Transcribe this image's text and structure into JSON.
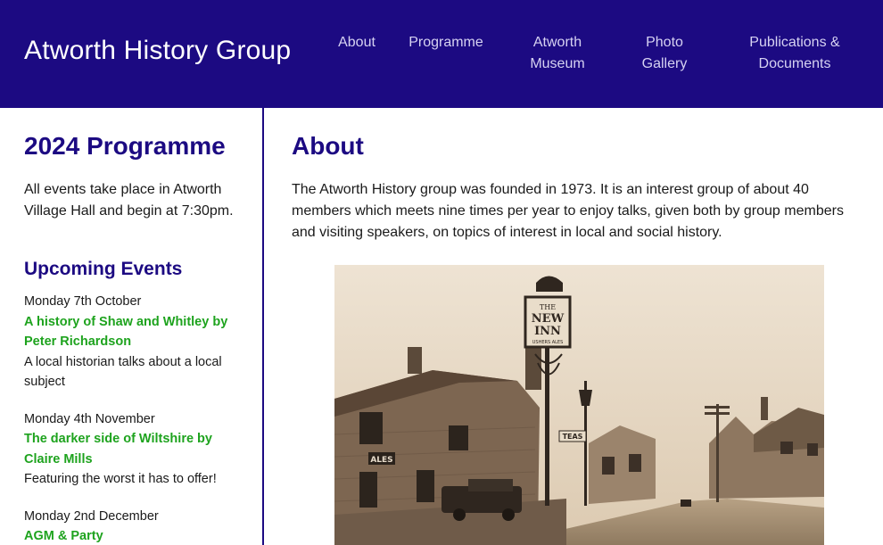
{
  "header": {
    "site_title": "Atworth History Group",
    "nav": [
      {
        "line1": "About",
        "line2": ""
      },
      {
        "line1": "Programme",
        "line2": ""
      },
      {
        "line1": "Atworth",
        "line2": "Museum"
      },
      {
        "line1": "Photo",
        "line2": "Gallery"
      },
      {
        "line1": "Publications &",
        "line2": "Documents"
      }
    ]
  },
  "sidebar": {
    "title": "2024 Programme",
    "intro": "All events take place in Atworth Village Hall and begin at 7:30pm.",
    "subtitle": "Upcoming Events",
    "events": [
      {
        "date": "Monday 7th October",
        "title": "A history of Shaw and Whitley by Peter Richardson",
        "desc": "A local historian talks about a local subject"
      },
      {
        "date": "Monday 4th November",
        "title": "The darker side of Wiltshire by Claire Mills",
        "desc": "Featuring the worst it has to offer!"
      },
      {
        "date": "Monday 2nd December",
        "title": "AGM & Party",
        "desc": ""
      }
    ]
  },
  "main": {
    "title": "About",
    "text": "The Atworth History group was founded in 1973. It is an interest group of about 40 members which meets nine times per year to enjoy talks, given both by group members and visiting speakers, on topics of interest in local and social history.",
    "photo": {
      "sign_line1": "THE",
      "sign_line2": "NEW",
      "sign_line3": "INN",
      "sign_line4": "USHERS ALES",
      "wall_sign": "ALES",
      "teas_sign": "TEAS"
    }
  },
  "colors": {
    "header_bg": "#1c0a82",
    "heading": "#1c0a82",
    "event_link": "#1ea31e",
    "nav_text": "#d6d2f2"
  }
}
